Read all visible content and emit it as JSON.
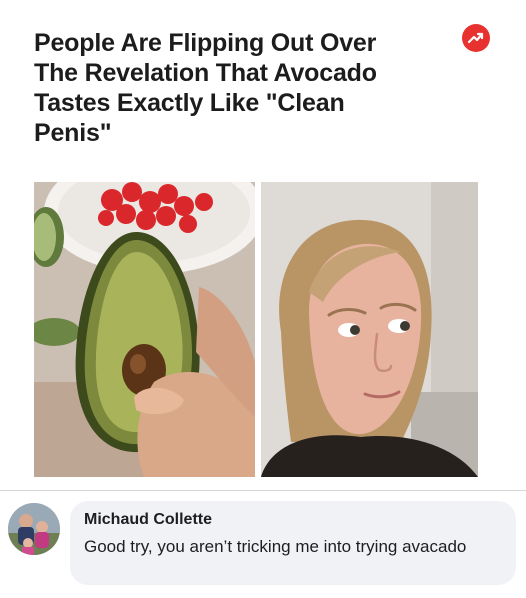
{
  "article": {
    "headline": "People Are Flipping Out Over\nThe Revelation That Avocado\nTastes Exactly Like \"Clean\nPenis\"",
    "trend_icon": "trending-arrow-icon",
    "accent_color": "#e8322f",
    "images": [
      {
        "subject": "halved avocado held in hand, tomatoes in bowl"
      },
      {
        "subject": "woman with skeptical side-eye expression"
      }
    ]
  },
  "comment": {
    "author": "Michaud Collette",
    "text": "Good try, you aren’t tricking me into trying avacado",
    "bubble_color": "#f0f2f5"
  }
}
